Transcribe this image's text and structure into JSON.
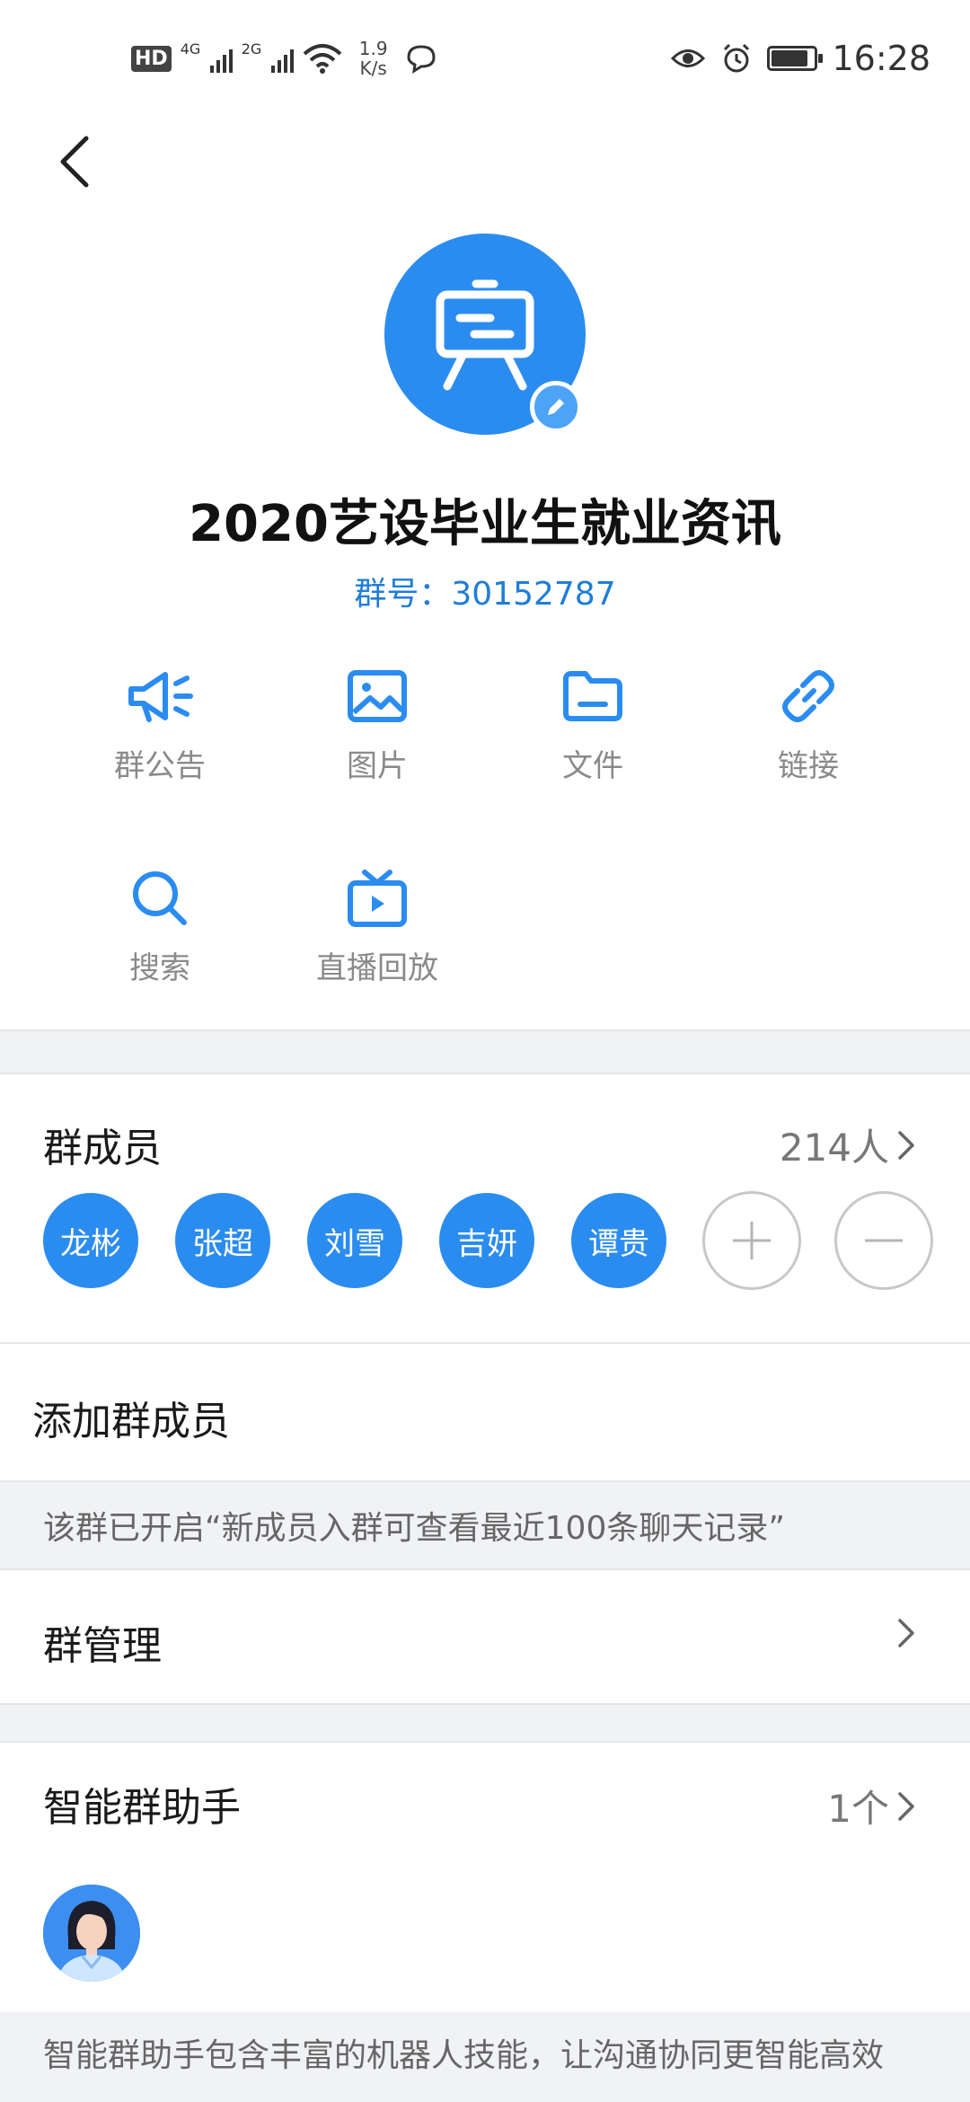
{
  "status_bar": {
    "hd": "HD",
    "net1": "4G",
    "net2": "2G",
    "speed_value": "1.9",
    "speed_unit": "K/s",
    "time": "16:28"
  },
  "group": {
    "name": "2020艺设毕业生就业资讯",
    "id_text": "群号：30152787"
  },
  "tools": [
    {
      "label": "群公告",
      "icon": "megaphone-icon"
    },
    {
      "label": "图片",
      "icon": "image-icon"
    },
    {
      "label": "文件",
      "icon": "folder-icon"
    },
    {
      "label": "链接",
      "icon": "link-icon"
    },
    {
      "label": "搜索",
      "icon": "search-icon"
    },
    {
      "label": "直播回放",
      "icon": "tv-icon"
    }
  ],
  "members_section": {
    "title": "群成员",
    "count": "214人",
    "members": [
      "龙彬",
      "张超",
      "刘雪",
      "吉妍",
      "谭贵"
    ]
  },
  "add_member": "添加群成员",
  "notice": "该群已开启“新成员入群可查看最近100条聊天记录”",
  "manage": "群管理",
  "assistant": {
    "title": "智能群助手",
    "count": "1个",
    "description": "智能群助手包含丰富的机器人技能，让沟通协同更智能高效"
  },
  "colors": {
    "accent": "#2b8cf0",
    "link_text": "#1f7dd6",
    "separator": "#f0f2f5"
  }
}
